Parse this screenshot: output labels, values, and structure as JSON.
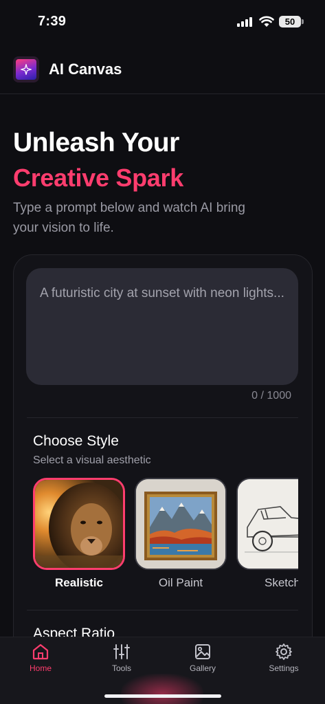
{
  "status_bar": {
    "time": "7:39",
    "battery": "50"
  },
  "app": {
    "title": "AI Canvas"
  },
  "hero": {
    "line1": "Unleash Your",
    "line2": "Creative Spark",
    "subtitle": "Type a prompt below and watch AI bring your vision to life."
  },
  "prompt": {
    "placeholder": "A futuristic city at sunset with neon lights...",
    "char_count": "0 / 1000"
  },
  "style_section": {
    "title": "Choose Style",
    "subtitle": "Select a visual aesthetic",
    "items": [
      {
        "label": "Realistic",
        "selected": true
      },
      {
        "label": "Oil Paint",
        "selected": false
      },
      {
        "label": "Sketch",
        "selected": false
      }
    ]
  },
  "aspect_section": {
    "title": "Aspect Ratio"
  },
  "tabs": [
    {
      "label": "Home",
      "icon": "home-icon",
      "active": true
    },
    {
      "label": "Tools",
      "icon": "sliders-icon",
      "active": false
    },
    {
      "label": "Gallery",
      "icon": "image-icon",
      "active": false
    },
    {
      "label": "Settings",
      "icon": "gear-icon",
      "active": false
    }
  ],
  "colors": {
    "accent": "#ff3d6e",
    "background": "#0e0e12",
    "card": "#131318",
    "input": "#2b2b35"
  }
}
